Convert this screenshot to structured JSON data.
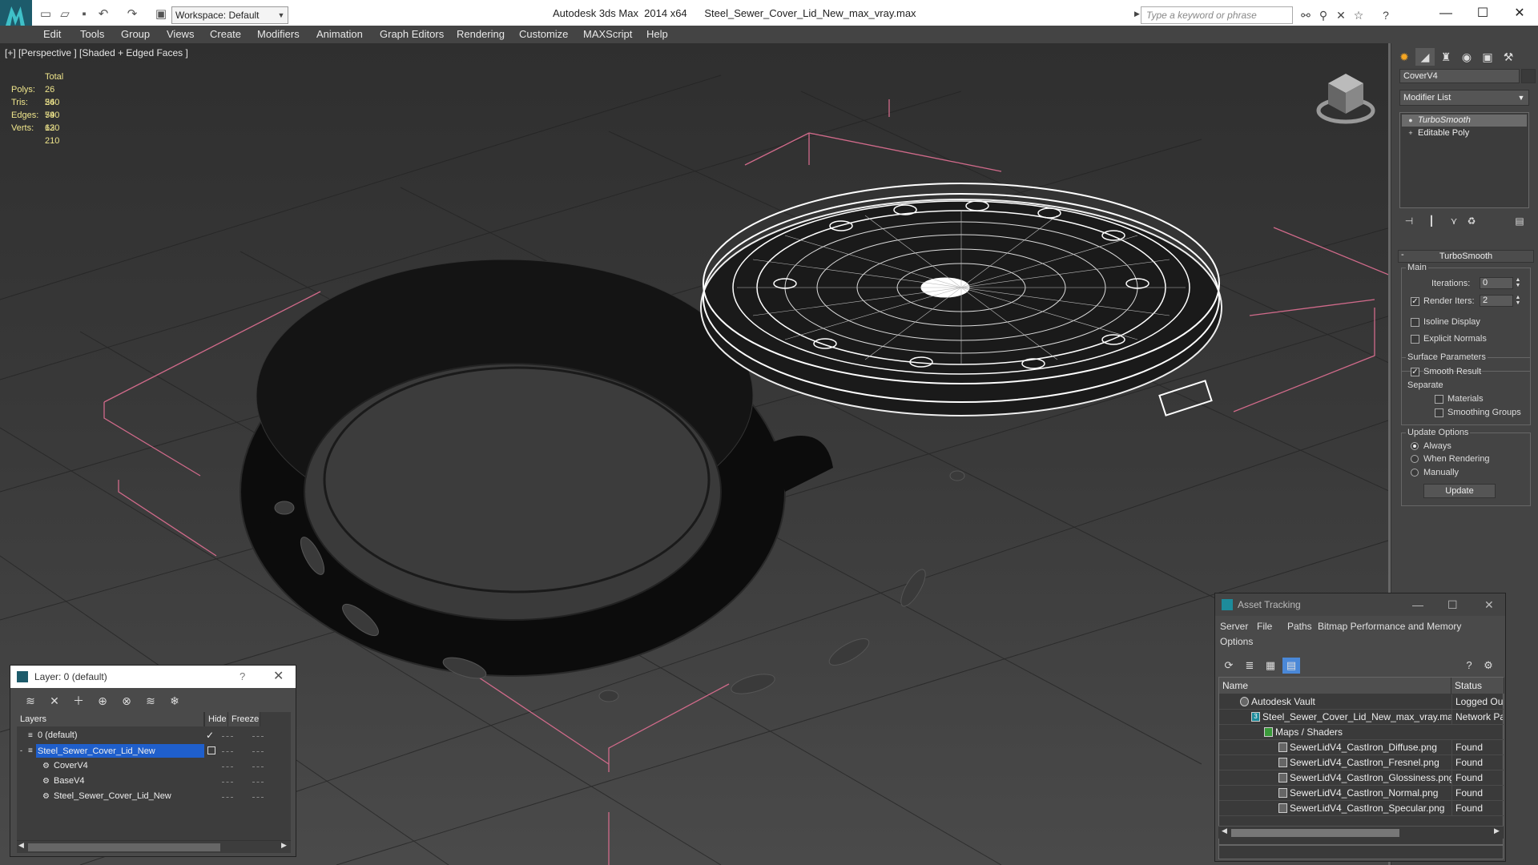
{
  "titlebar": {
    "workspace": "Workspace: Default",
    "app_title": "Autodesk 3ds Max  2014 x64      Steel_Sewer_Cover_Lid_New_max_vray.max",
    "search_placeholder": "Type a keyword or phrase"
  },
  "menu": [
    "Edit",
    "Tools",
    "Group",
    "Views",
    "Create",
    "Modifiers",
    "Animation",
    "Graph Editors",
    "Rendering",
    "Customize",
    "MAXScript",
    "Help"
  ],
  "viewport": {
    "label": "[+] [Perspective ] [Shaded + Edged Faces ]",
    "stats": {
      "header": "Total",
      "polys_label": "Polys:",
      "polys": "26 540",
      "tris_label": "Tris:",
      "tris": "26 540",
      "edges_label": "Edges:",
      "edges": "79 620",
      "verts_label": "Verts:",
      "verts": "13 210"
    }
  },
  "command_panel": {
    "object_name": "CoverV4",
    "modifier_list": "Modifier List",
    "stack": [
      "TurboSmooth",
      "Editable Poly"
    ],
    "rollout": {
      "title": "TurboSmooth",
      "main_label": "Main",
      "iterations_label": "Iterations:",
      "iterations": "0",
      "render_iters_label": "Render Iters:",
      "render_iters": "2",
      "isoline": "Isoline Display",
      "explicit_normals": "Explicit Normals",
      "surface_params": "Surface Parameters",
      "smooth_result": "Smooth Result",
      "separate": "Separate",
      "materials": "Materials",
      "smoothing_groups": "Smoothing Groups",
      "update_options": "Update Options",
      "always": "Always",
      "when_rendering": "When Rendering",
      "manually": "Manually",
      "update_button": "Update"
    }
  },
  "layer_dialog": {
    "title": "Layer: 0 (default)",
    "help": "?",
    "columns": {
      "layers": "Layers",
      "hide": "Hide",
      "freeze": "Freeze"
    },
    "rows": [
      "0 (default)",
      "Steel_Sewer_Cover_Lid_New",
      "CoverV4",
      "BaseV4",
      "Steel_Sewer_Cover_Lid_New"
    ]
  },
  "asset_dialog": {
    "title": "Asset Tracking",
    "menu": [
      "Server",
      "File",
      "Paths",
      "Bitmap Performance and Memory",
      "Options"
    ],
    "columns": {
      "name": "Name",
      "status": "Status"
    },
    "rows": [
      {
        "name": "Autodesk Vault",
        "status": "Logged Out"
      },
      {
        "name": "Steel_Sewer_Cover_Lid_New_max_vray.max",
        "status": "Network Pat"
      },
      {
        "name": "Maps / Shaders",
        "status": ""
      },
      {
        "name": "SewerLidV4_CastIron_Diffuse.png",
        "status": "Found"
      },
      {
        "name": "SewerLidV4_CastIron_Fresnel.png",
        "status": "Found"
      },
      {
        "name": "SewerLidV4_CastIron_Glossiness.png",
        "status": "Found"
      },
      {
        "name": "SewerLidV4_CastIron_Normal.png",
        "status": "Found"
      },
      {
        "name": "SewerLidV4_CastIron_Specular.png",
        "status": "Found"
      }
    ]
  }
}
